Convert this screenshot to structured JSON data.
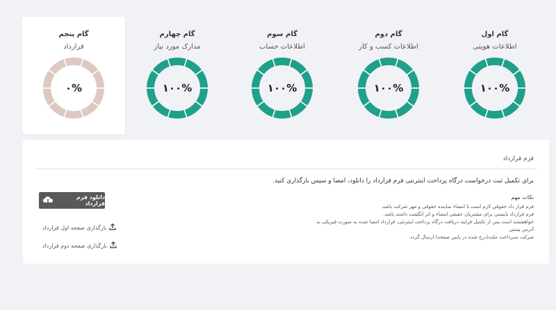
{
  "colors": {
    "complete": "#1fa08a",
    "pending": "#dcc9c1",
    "page_bg": "#f1f2f6",
    "card_bg": "#ffffff",
    "button_bg": "#595959"
  },
  "steps": [
    {
      "title": "گام اول",
      "subtitle": "اطلاعات هویتی",
      "progress_label": "۱۰۰%",
      "progress": 100,
      "active": false
    },
    {
      "title": "گام دوم",
      "subtitle": "اطلاعات کسب و کار",
      "progress_label": "۱۰۰%",
      "progress": 100,
      "active": false
    },
    {
      "title": "گام سوم",
      "subtitle": "اطلاعات حساب",
      "progress_label": "۱۰۰%",
      "progress": 100,
      "active": false
    },
    {
      "title": "گام چهارم",
      "subtitle": "مدارک مورد نیاز",
      "progress_label": "۱۰۰%",
      "progress": 100,
      "active": false
    },
    {
      "title": "گام پنجم",
      "subtitle": "قرارداد",
      "progress_label": "۰%",
      "progress": 0,
      "active": true
    }
  ],
  "contract": {
    "header": "فرم قرارداد",
    "intro": "برای تکمیل ثبت درخواست درگاه پرداخت اینترنتی فرم قرارداد را دانلود، امضا و سپس بارگذاری کنید.",
    "notes_title": "نکات مهم",
    "notes": [
      "فرم قرار داد حقوقی لازم است با امضاء نماینده حقوقی و مهر شرکت باشد.",
      "فرم قرارداد بایستی برای مشتریان حقیقی امضاء و اثر انگشت داشته باشد.",
      "خواهشمند است پس از تکمیل فرایند دریافت درگاه پرداخت اینترنتی، قرارداد امضا شده به صورت فیزیکی به آدرس پستی",
      "شرکت به‌پرداخت ملت(درج شده در پایین صفحه) ارسال گردد."
    ],
    "download_label": "دانلود فرم قرارداد",
    "download_icon": "download-cloud-icon",
    "upload_first_label": "بارگذاری صفحه اول قرارداد",
    "upload_second_label": "بارگذاری صفحه دوم قرارداد",
    "upload_icon": "upload-icon"
  }
}
